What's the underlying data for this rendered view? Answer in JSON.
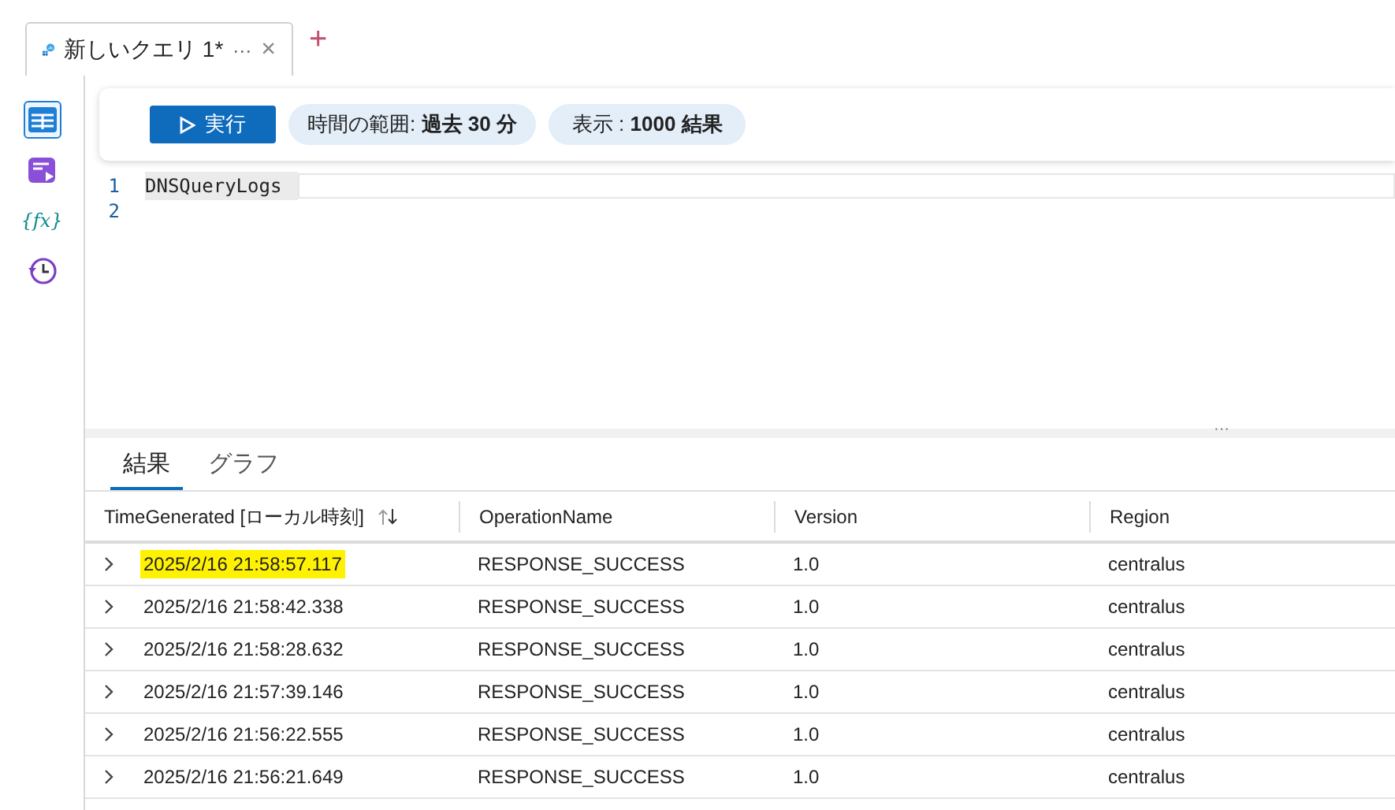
{
  "tabs": [
    {
      "label": "新しいクエリ 1*",
      "more": "···",
      "close": "×",
      "selected": true
    }
  ],
  "new_tab": "+",
  "sidebar": {
    "items": [
      {
        "kind": "tables",
        "selected": true
      },
      {
        "kind": "queries",
        "selected": false
      },
      {
        "kind": "functions",
        "glyph": "{fx}",
        "selected": false
      },
      {
        "kind": "history",
        "selected": false
      }
    ]
  },
  "toolbar": {
    "run_button": "実行",
    "time_range": {
      "label": "時間の範囲:",
      "value": "過去 30 分"
    },
    "limit": {
      "label": "表示 :",
      "value": "1000 結果"
    }
  },
  "editor": {
    "lines": [
      {
        "number": "1",
        "code": "DNSQueryLogs"
      },
      {
        "number": "2"
      }
    ]
  },
  "splitter": "···",
  "result_tabs": [
    {
      "label": "結果",
      "selected": true
    },
    {
      "label": "グラフ",
      "selected": false
    }
  ],
  "table": {
    "columns": [
      {
        "label": "TimeGenerated [ローカル時刻]",
        "sortable": true
      },
      {
        "label": "OperationName",
        "sortable": false
      },
      {
        "label": "Version",
        "sortable": false
      },
      {
        "label": "Region",
        "sortable": false
      }
    ],
    "rows": [
      {
        "cells": [
          "2025/2/16 21:58:57.117",
          "RESPONSE_SUCCESS",
          "1.0",
          "centralus"
        ],
        "highlighted": true
      },
      {
        "cells": [
          "2025/2/16 21:58:42.338",
          "RESPONSE_SUCCESS",
          "1.0",
          "centralus"
        ],
        "highlighted": false
      },
      {
        "cells": [
          "2025/2/16 21:58:28.632",
          "RESPONSE_SUCCESS",
          "1.0",
          "centralus"
        ],
        "highlighted": false
      },
      {
        "cells": [
          "2025/2/16 21:57:39.146",
          "RESPONSE_SUCCESS",
          "1.0",
          "centralus"
        ],
        "highlighted": false
      },
      {
        "cells": [
          "2025/2/16 21:56:22.555",
          "RESPONSE_SUCCESS",
          "1.0",
          "centralus"
        ],
        "highlighted": false
      },
      {
        "cells": [
          "2025/2/16 21:56:21.649",
          "RESPONSE_SUCCESS",
          "1.0",
          "centralus"
        ],
        "highlighted": false
      }
    ]
  }
}
